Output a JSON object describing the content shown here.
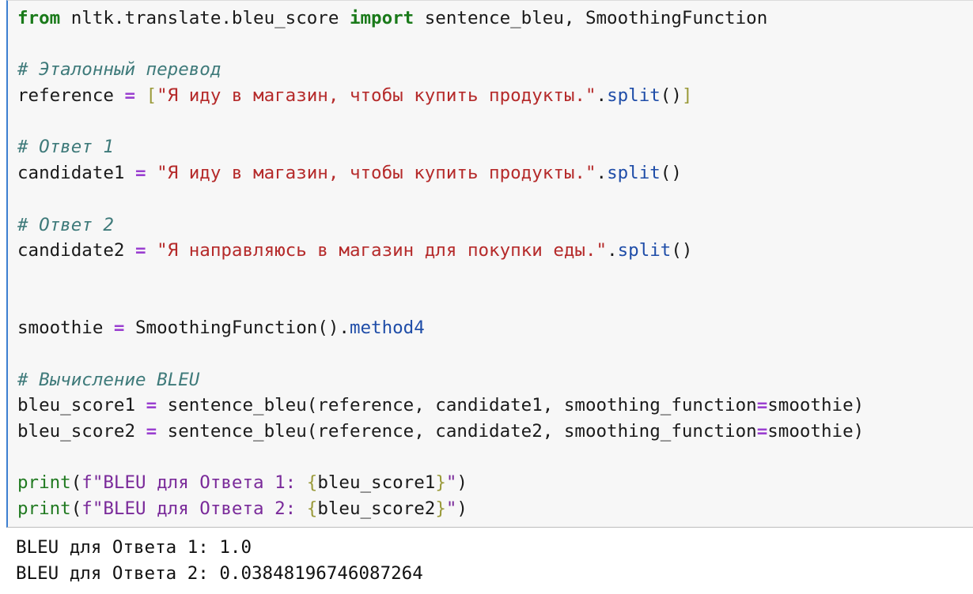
{
  "code": {
    "l1": {
      "from": "from",
      "mod": " nltk.translate.bleu_score ",
      "import": "import",
      "names": " sentence_bleu, SmoothingFunction"
    },
    "l3": {
      "comment": "# Эталонный перевод"
    },
    "l4": {
      "var": "reference ",
      "eq": "=",
      "sp": " ",
      "lb": "[",
      "str": "\"Я иду в магазин, чтобы купить продукты.\"",
      "dot": ".",
      "method": "split",
      "call": "()",
      "rb": "]"
    },
    "l6": {
      "comment": "# Ответ 1"
    },
    "l7": {
      "var": "candidate1 ",
      "eq": "=",
      "sp": " ",
      "str": "\"Я иду в магазин, чтобы купить продукты.\"",
      "dot": ".",
      "method": "split",
      "call": "()"
    },
    "l9": {
      "comment": "# Ответ 2"
    },
    "l10": {
      "var": "candidate2 ",
      "eq": "=",
      "sp": " ",
      "str": "\"Я направляюсь в магазин для покупки еды.\"",
      "dot": ".",
      "method": "split",
      "call": "()"
    },
    "l13": {
      "var": "smoothie ",
      "eq": "=",
      "rest": " SmoothingFunction().",
      "method": "method4"
    },
    "l15": {
      "comment": "# Вычисление BLEU"
    },
    "l16": {
      "var": "bleu_score1 ",
      "eq": "=",
      "rest": " sentence_bleu(reference, candidate1, smoothing_function",
      "eq2": "=",
      "tail": "smoothie)"
    },
    "l17": {
      "var": "bleu_score2 ",
      "eq": "=",
      "rest": " sentence_bleu(reference, candidate2, smoothing_function",
      "eq2": "=",
      "tail": "smoothie)"
    },
    "l19": {
      "print": "print",
      "open": "(",
      "fstr": "f\"BLEU для Ответа 1: ",
      "lb": "{",
      "expr": "bleu_score1",
      "rb": "}",
      "fend": "\"",
      "close": ")"
    },
    "l20": {
      "print": "print",
      "open": "(",
      "fstr": "f\"BLEU для Ответа 2: ",
      "lb": "{",
      "expr": "bleu_score2",
      "rb": "}",
      "fend": "\"",
      "close": ")"
    }
  },
  "output": {
    "line1": "BLEU для Ответа 1: 1.0",
    "line2": "BLEU для Ответа 2: 0.03848196746087264"
  }
}
